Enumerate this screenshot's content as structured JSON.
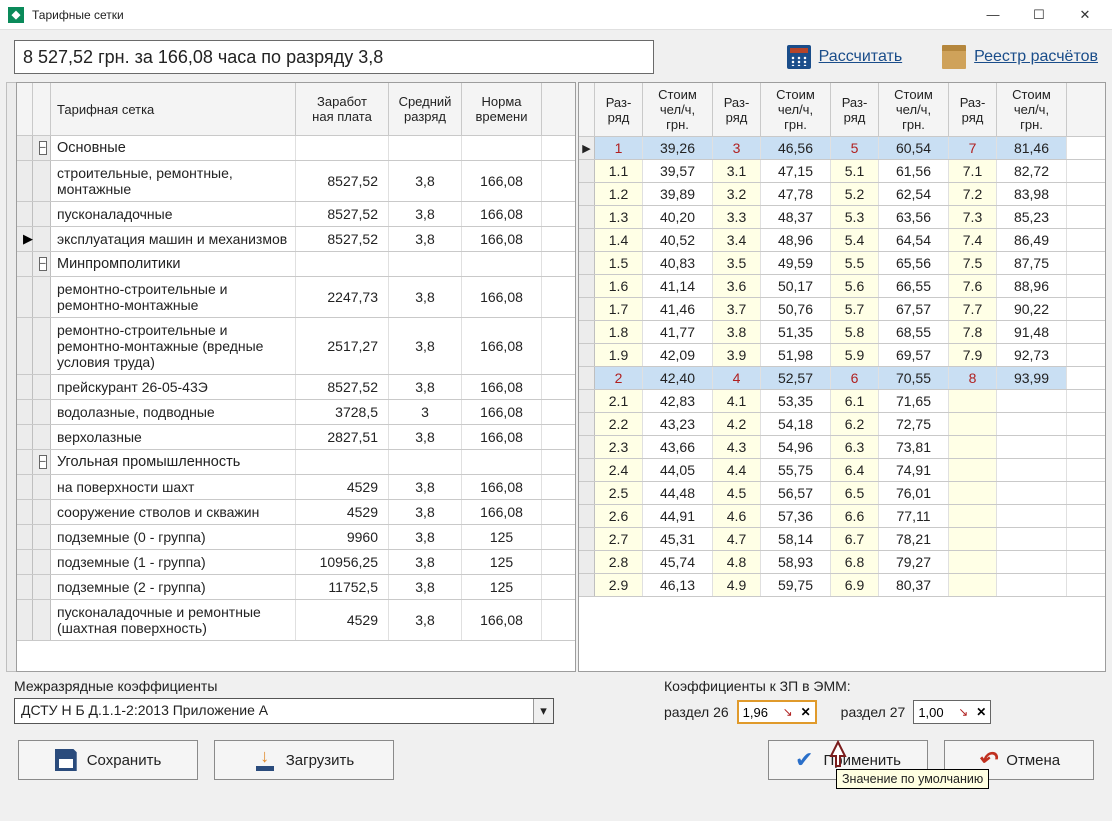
{
  "window": {
    "title": "Тарифные сетки",
    "minimize": "—",
    "maximize": "☐",
    "close": "✕"
  },
  "toolbar": {
    "summary": "8 527,52 грн. за 166,08 часа  по разряду 3,8",
    "calc_label": "Рассчитать",
    "registry_label": "Реестр расчётов"
  },
  "left_table": {
    "headers": {
      "name": "Тарифная сетка",
      "salary": "Заработ\nная плата",
      "rank": "Средний разряд",
      "norm": "Норма времени"
    },
    "rows": [
      {
        "type": "group",
        "collapse": "⊟",
        "name": "Основные"
      },
      {
        "type": "item",
        "arrow": "",
        "name": "строительные, ремонтные, монтажные",
        "salary": "8527,52",
        "rank": "3,8",
        "norm": "166,08"
      },
      {
        "type": "item",
        "arrow": "",
        "name": "пусконаладочные",
        "salary": "8527,52",
        "rank": "3,8",
        "norm": "166,08"
      },
      {
        "type": "item",
        "arrow": "▸",
        "name": "эксплуатация машин и механизмов",
        "salary": "8527,52",
        "rank": "3,8",
        "norm": "166,08"
      },
      {
        "type": "group",
        "collapse": "⊟",
        "name": "Минпромполитики"
      },
      {
        "type": "item",
        "name": "ремонтно-строительные и ремонтно-монтажные",
        "salary": "2247,73",
        "rank": "3,8",
        "norm": "166,08"
      },
      {
        "type": "item",
        "name": "ремонтно-строительные и ремонтно-монтажные (вредные условия труда)",
        "salary": "2517,27",
        "rank": "3,8",
        "norm": "166,08"
      },
      {
        "type": "item",
        "name": "прейскурант 26-05-43Э",
        "salary": "8527,52",
        "rank": "3,8",
        "norm": "166,08"
      },
      {
        "type": "item",
        "name": "водолазные, подводные",
        "salary": "3728,5",
        "rank": "3",
        "norm": "166,08"
      },
      {
        "type": "item",
        "name": "верхолазные",
        "salary": "2827,51",
        "rank": "3,8",
        "norm": "166,08"
      },
      {
        "type": "group",
        "collapse": "⊟",
        "name": "Угольная промышленность"
      },
      {
        "type": "item",
        "name": "на поверхности шахт",
        "salary": "4529",
        "rank": "3,8",
        "norm": "166,08"
      },
      {
        "type": "item",
        "name": "сооружение стволов и скважин",
        "salary": "4529",
        "rank": "3,8",
        "norm": "166,08"
      },
      {
        "type": "item",
        "name": "подземные (0 - группа)",
        "salary": "9960",
        "rank": "3,8",
        "norm": "125"
      },
      {
        "type": "item",
        "name": "подземные (1 - группа)",
        "salary": "10956,25",
        "rank": "3,8",
        "norm": "125"
      },
      {
        "type": "item",
        "name": "подземные (2 - группа)",
        "salary": "11752,5",
        "rank": "3,8",
        "norm": "125"
      },
      {
        "type": "item",
        "name": "пусконаладочные и ремонтные (шахтная поверхность)",
        "salary": "4529",
        "rank": "3,8",
        "norm": "166,08"
      }
    ]
  },
  "right_table": {
    "headers": {
      "rank": "Раз-\nряд",
      "cost": "Стоим\nчел/ч,\nгрн."
    },
    "rows": [
      {
        "hl": true,
        "r1": "1",
        "c1": "39,26",
        "r2": "3",
        "c2": "46,56",
        "r3": "5",
        "c3": "60,54",
        "r4": "7",
        "c4": "81,46"
      },
      {
        "r1": "1.1",
        "c1": "39,57",
        "r2": "3.1",
        "c2": "47,15",
        "r3": "5.1",
        "c3": "61,56",
        "r4": "7.1",
        "c4": "82,72"
      },
      {
        "r1": "1.2",
        "c1": "39,89",
        "r2": "3.2",
        "c2": "47,78",
        "r3": "5.2",
        "c3": "62,54",
        "r4": "7.2",
        "c4": "83,98"
      },
      {
        "r1": "1.3",
        "c1": "40,20",
        "r2": "3.3",
        "c2": "48,37",
        "r3": "5.3",
        "c3": "63,56",
        "r4": "7.3",
        "c4": "85,23"
      },
      {
        "r1": "1.4",
        "c1": "40,52",
        "r2": "3.4",
        "c2": "48,96",
        "r3": "5.4",
        "c3": "64,54",
        "r4": "7.4",
        "c4": "86,49"
      },
      {
        "r1": "1.5",
        "c1": "40,83",
        "r2": "3.5",
        "c2": "49,59",
        "r3": "5.5",
        "c3": "65,56",
        "r4": "7.5",
        "c4": "87,75"
      },
      {
        "r1": "1.6",
        "c1": "41,14",
        "r2": "3.6",
        "c2": "50,17",
        "r3": "5.6",
        "c3": "66,55",
        "r4": "7.6",
        "c4": "88,96"
      },
      {
        "r1": "1.7",
        "c1": "41,46",
        "r2": "3.7",
        "c2": "50,76",
        "r3": "5.7",
        "c3": "67,57",
        "r4": "7.7",
        "c4": "90,22"
      },
      {
        "r1": "1.8",
        "c1": "41,77",
        "r2": "3.8",
        "c2": "51,35",
        "r3": "5.8",
        "c3": "68,55",
        "r4": "7.8",
        "c4": "91,48"
      },
      {
        "r1": "1.9",
        "c1": "42,09",
        "r2": "3.9",
        "c2": "51,98",
        "r3": "5.9",
        "c3": "69,57",
        "r4": "7.9",
        "c4": "92,73"
      },
      {
        "hl": true,
        "r1": "2",
        "c1": "42,40",
        "r2": "4",
        "c2": "52,57",
        "r3": "6",
        "c3": "70,55",
        "r4": "8",
        "c4": "93,99"
      },
      {
        "r1": "2.1",
        "c1": "42,83",
        "r2": "4.1",
        "c2": "53,35",
        "r3": "6.1",
        "c3": "71,65",
        "r4": "",
        "c4": ""
      },
      {
        "r1": "2.2",
        "c1": "43,23",
        "r2": "4.2",
        "c2": "54,18",
        "r3": "6.2",
        "c3": "72,75",
        "r4": "",
        "c4": ""
      },
      {
        "r1": "2.3",
        "c1": "43,66",
        "r2": "4.3",
        "c2": "54,96",
        "r3": "6.3",
        "c3": "73,81",
        "r4": "",
        "c4": ""
      },
      {
        "r1": "2.4",
        "c1": "44,05",
        "r2": "4.4",
        "c2": "55,75",
        "r3": "6.4",
        "c3": "74,91",
        "r4": "",
        "c4": ""
      },
      {
        "r1": "2.5",
        "c1": "44,48",
        "r2": "4.5",
        "c2": "56,57",
        "r3": "6.5",
        "c3": "76,01",
        "r4": "",
        "c4": ""
      },
      {
        "r1": "2.6",
        "c1": "44,91",
        "r2": "4.6",
        "c2": "57,36",
        "r3": "6.6",
        "c3": "77,11",
        "r4": "",
        "c4": ""
      },
      {
        "r1": "2.7",
        "c1": "45,31",
        "r2": "4.7",
        "c2": "58,14",
        "r3": "6.7",
        "c3": "78,21",
        "r4": "",
        "c4": ""
      },
      {
        "r1": "2.8",
        "c1": "45,74",
        "r2": "4.8",
        "c2": "58,93",
        "r3": "6.8",
        "c3": "79,27",
        "r4": "",
        "c4": ""
      },
      {
        "r1": "2.9",
        "c1": "46,13",
        "r2": "4.9",
        "c2": "59,75",
        "r3": "6.9",
        "c3": "80,37",
        "r4": "",
        "c4": ""
      }
    ]
  },
  "bottom": {
    "inter_label": "Межразрядные коэффициенты",
    "inter_value": "ДСТУ Н Б Д.1.1-2:2013 Приложение А",
    "coef_label": "Коэффициенты к ЗП в ЭММ:",
    "r26_label": "раздел 26",
    "r26_value": "1,96",
    "r27_label": "раздел 27",
    "r27_value": "1,00",
    "reset_glyph": "↘",
    "clear_glyph": "✕",
    "tooltip": "Значение по умолчанию"
  },
  "buttons": {
    "save": "Сохранить",
    "load": "Загрузить",
    "apply": "Применить",
    "cancel": "Отмена"
  }
}
